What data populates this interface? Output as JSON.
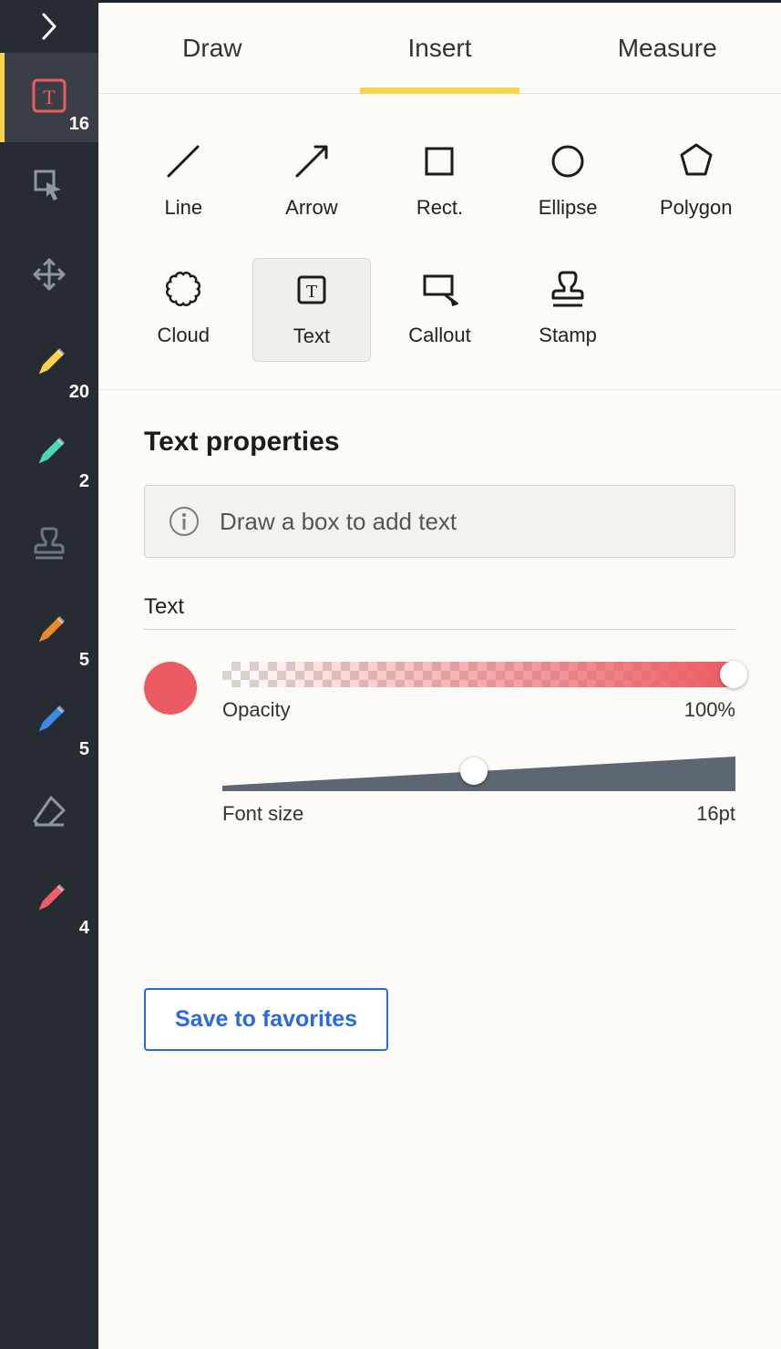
{
  "sidebar": {
    "items": [
      {
        "name": "text-tool",
        "badge": "16",
        "active": true,
        "icon": "text",
        "color": "#ec5b62"
      },
      {
        "name": "select-tool",
        "badge": "",
        "icon": "cursor",
        "color": "#8f97a1"
      },
      {
        "name": "move-tool",
        "badge": "",
        "icon": "move",
        "color": "#8f97a1"
      },
      {
        "name": "pen-yellow",
        "badge": "20",
        "icon": "pen",
        "color": "#f7d44c"
      },
      {
        "name": "pen-teal",
        "badge": "2",
        "icon": "pen",
        "color": "#4dd9b0"
      },
      {
        "name": "stamp-tool",
        "badge": "",
        "icon": "stamp",
        "color": "#6d7682"
      },
      {
        "name": "pen-orange",
        "badge": "5",
        "icon": "pen",
        "color": "#e98a2e"
      },
      {
        "name": "pen-blue",
        "badge": "5",
        "icon": "pen",
        "color": "#3c8be8"
      },
      {
        "name": "eraser-tool",
        "badge": "",
        "icon": "eraser",
        "color": "#8f97a1"
      },
      {
        "name": "pen-pink",
        "badge": "4",
        "icon": "pen",
        "color": "#ee5f6a"
      }
    ]
  },
  "tabs": [
    {
      "label": "Draw",
      "active": false
    },
    {
      "label": "Insert",
      "active": true
    },
    {
      "label": "Measure",
      "active": false
    }
  ],
  "shapes": [
    {
      "label": "Line",
      "selected": false
    },
    {
      "label": "Arrow",
      "selected": false
    },
    {
      "label": "Rect.",
      "selected": false
    },
    {
      "label": "Ellipse",
      "selected": false
    },
    {
      "label": "Polygon",
      "selected": false
    },
    {
      "label": "Cloud",
      "selected": false
    },
    {
      "label": "Text",
      "selected": true
    },
    {
      "label": "Callout",
      "selected": false
    },
    {
      "label": "Stamp",
      "selected": false
    }
  ],
  "properties": {
    "title": "Text properties",
    "hint": "Draw a box to add text",
    "section_label": "Text",
    "color": "#ec5b62",
    "opacity_label": "Opacity",
    "opacity_value": "100%",
    "opacity_percent": 100,
    "font_size_label": "Font size",
    "font_size_value": "16pt",
    "save_label": "Save to favorites"
  }
}
